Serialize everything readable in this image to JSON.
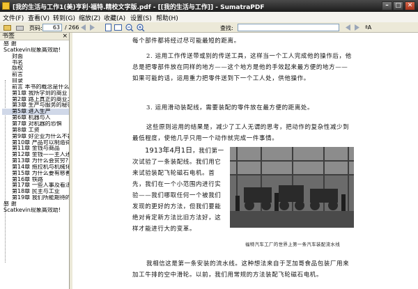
{
  "window": {
    "title": "[我的生活与工作1(美)亨利·福特.精校文字版.pdf - [[我的生活与工作]] - SumatraPDF",
    "minimize": "–",
    "maximize": "□",
    "close": "✕"
  },
  "menu": {
    "items": [
      "文件(F)",
      "查看(V)",
      "转到(G)",
      "缩放(Z)",
      "收藏(A)",
      "设置(S)",
      "帮助(H)"
    ]
  },
  "toolbar": {
    "page_label": "页码:",
    "page_value": "63",
    "page_total": "/ 266",
    "find_label": "查找:",
    "search_placeholder": "",
    "match_case_label": "ªA",
    "icons": [
      "open-icon",
      "prev-page-icon",
      "next-page-icon",
      "fit-page-icon",
      "fit-width-icon",
      "zoom-out-icon",
      "zoom-in-icon",
      "find-prev-icon",
      "find-next-icon"
    ]
  },
  "sidebar": {
    "title": "书签",
    "close": "×",
    "items": [
      {
        "label": "感 谢",
        "top": true
      },
      {
        "label": "Scatkevin现象高效助!",
        "top": true
      },
      {
        "label": "封面",
        "top": false
      },
      {
        "label": "书名",
        "top": false
      },
      {
        "label": "版权",
        "top": false
      },
      {
        "label": "前言",
        "top": false
      },
      {
        "label": "目录",
        "top": false
      },
      {
        "label": "前言 本书的概念是什么",
        "top": false
      },
      {
        "label": "第1章 我所学到的商业",
        "top": false
      },
      {
        "label": "第2章 路上真正的商业之",
        "top": false
      },
      {
        "label": "第3章 生产与服务的秘密",
        "top": false
      },
      {
        "label": "第5章 进入生产",
        "top": false,
        "selected": true
      },
      {
        "label": "第6章 机器与人",
        "top": false
      },
      {
        "label": "第7章 对机器的恐惧",
        "top": false
      },
      {
        "label": "第8章 工资",
        "top": false
      },
      {
        "label": "第9章 好企业为什么不裁",
        "top": false
      },
      {
        "label": "第10章 产品可以制造得",
        "top": false
      },
      {
        "label": "第11章 金钱与商品",
        "top": false
      },
      {
        "label": "第12章 金钱——主人还是",
        "top": false
      },
      {
        "label": "第13章 为什么会贫穷?",
        "top": false
      },
      {
        "label": "第14章 拖拉机与机械化",
        "top": false
      },
      {
        "label": "第15章 为什么要有慈善",
        "top": false
      },
      {
        "label": "第16章 铁路",
        "top": false
      },
      {
        "label": "第17章 一些人事及看法",
        "top": false
      },
      {
        "label": "第18章 民主与工业",
        "top": false
      },
      {
        "label": "第19章 我们所能期待的",
        "top": false
      },
      {
        "label": "感 谢",
        "top": true
      },
      {
        "label": "Scatkevin现象高效助!",
        "top": true
      }
    ]
  },
  "document": {
    "line1": "每个部件都将经过尽可能最短的距离。",
    "item2": "2. 运用工作传送带或别的传送工具，这样当一个工人完成他的操作后，他总是把零部件放在同样的地方——这个地方是他的手效起来最方便的地方——如果可能的话，运用重力把零件送到下一个工人处，供他操作。",
    "item3": "3. 运用滑动装配线，需要装配的零件放在最方便的距离处。",
    "para1": "这些原则运用的结果是，减少了工人无谓的思考，把动作的复杂性减少到最低程度，使他几乎只用一个动作就完成一件事情。",
    "date_prefix": "1913年4月1日",
    "para2": "，我们第一次试验了一条装配线。我们用它来试验装配飞轮磁石电机。首先，我们在一个小范围内进行实验——我们哪取任何一个被我们发现的更好的方法，但我们要能绝对肯定新方法比旧方法好，这样才能进行大的变革。",
    "caption": "福特汽车工厂的世界上第一条汽车装配流水线",
    "para3": "我相信这是第一条安装的流水线。这种想法来自于芝加哥食品包装厂用来加工牛排的空中滑轮。以前，我们用常规的方法装配飞轮磁石电机。"
  }
}
